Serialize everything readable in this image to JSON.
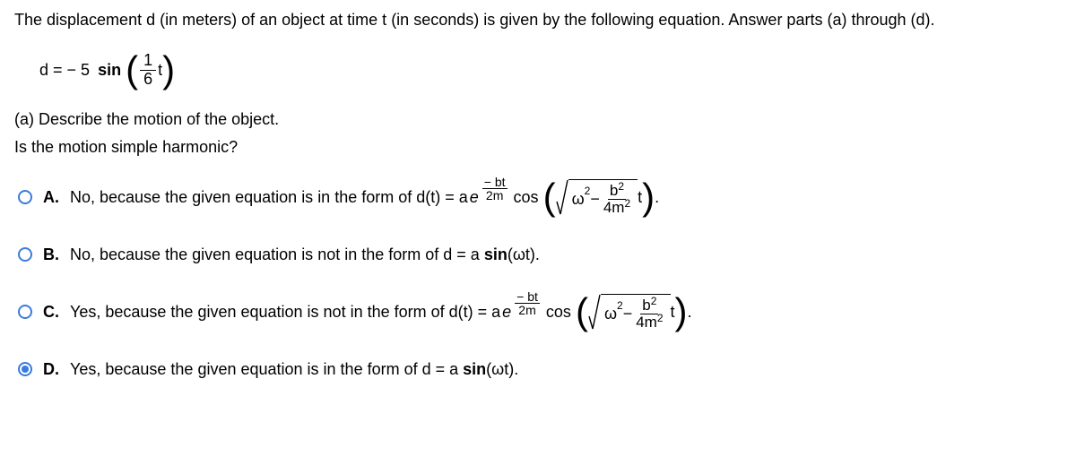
{
  "prompt": "The displacement d (in meters) of an object at time t (in seconds) is given by the following equation. Answer parts (a) through (d).",
  "equation": {
    "lhs": "d = − 5",
    "func": "sin",
    "frac_num": "1",
    "frac_den": "6",
    "var": "t"
  },
  "part_a": "(a) Describe the motion of the object.",
  "sub_question": "Is the motion simple harmonic?",
  "options": {
    "A": {
      "letter": "A.",
      "prefix": "No, because the given equation is in the form of d(t) = a",
      "cos": "cos",
      "exp_num": "− bt",
      "exp_den": "2m",
      "omega": "ω",
      "sq": "2",
      "minus": " − ",
      "b2": "b",
      "b2_sup": "2",
      "den4m2": "4m",
      "den4m2_sup": "2",
      "t": "t",
      "end": "."
    },
    "B": {
      "letter": "B.",
      "text": "No, because the given equation is not in the form of d = a",
      "sin": "sin",
      "omega_t": " (ωt).",
      "selected": false
    },
    "C": {
      "letter": "C.",
      "prefix": "Yes, because the given equation is not in the form of d(t) = a",
      "cos": "cos",
      "exp_num": "− bt",
      "exp_den": "2m",
      "omega": "ω",
      "sq": "2",
      "minus": " − ",
      "b2": "b",
      "b2_sup": "2",
      "den4m2": "4m",
      "den4m2_sup": "2",
      "t": "t",
      "end": "."
    },
    "D": {
      "letter": "D.",
      "text": "Yes, because the given equation is in the form of d = a",
      "sin": "sin",
      "omega_t": " (ωt).",
      "selected": true
    }
  }
}
